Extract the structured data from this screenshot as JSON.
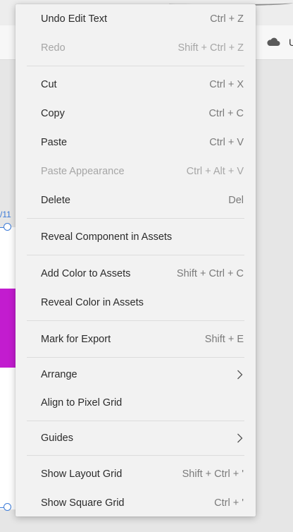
{
  "background": {
    "artboard_label": "/11",
    "user_label": "U",
    "accent_color": "#c21ccf"
  },
  "menu": {
    "items": [
      {
        "label": "Undo Edit Text",
        "shortcut": "Ctrl + Z",
        "disabled": false
      },
      {
        "label": "Redo",
        "shortcut": "Shift + Ctrl + Z",
        "disabled": true
      },
      {
        "label": "Cut",
        "shortcut": "Ctrl + X",
        "disabled": false
      },
      {
        "label": "Copy",
        "shortcut": "Ctrl + C",
        "disabled": false
      },
      {
        "label": "Paste",
        "shortcut": "Ctrl + V",
        "disabled": false
      },
      {
        "label": "Paste Appearance",
        "shortcut": "Ctrl + Alt + V",
        "disabled": true
      },
      {
        "label": "Delete",
        "shortcut": "Del",
        "disabled": false
      },
      {
        "label": "Reveal Component in Assets",
        "shortcut": "",
        "disabled": false
      },
      {
        "label": "Add Color to Assets",
        "shortcut": "Shift + Ctrl + C",
        "disabled": false
      },
      {
        "label": "Reveal Color in Assets",
        "shortcut": "",
        "disabled": false
      },
      {
        "label": "Mark for Export",
        "shortcut": "Shift + E",
        "disabled": false
      },
      {
        "label": "Arrange",
        "shortcut": "",
        "submenu": true,
        "disabled": false
      },
      {
        "label": "Align to Pixel Grid",
        "shortcut": "",
        "disabled": false
      },
      {
        "label": "Guides",
        "shortcut": "",
        "submenu": true,
        "disabled": false
      },
      {
        "label": "Show Layout Grid",
        "shortcut": "Shift + Ctrl + '",
        "disabled": false
      },
      {
        "label": "Show Square Grid",
        "shortcut": "Ctrl + '",
        "disabled": false
      }
    ]
  }
}
